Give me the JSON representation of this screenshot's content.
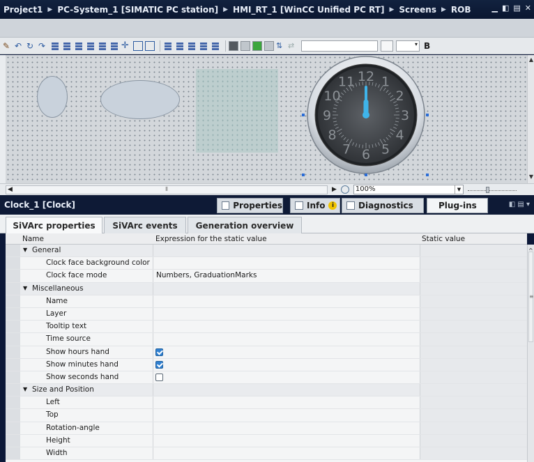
{
  "breadcrumb": [
    "Project1",
    "PC-System_1 [SIMATIC PC station]",
    "HMI_RT_1 [WinCC Unified PC RT]",
    "Screens",
    "ROB"
  ],
  "toolbar": {
    "bold_label": "B"
  },
  "canvas": {
    "clock_numbers": [
      "12",
      "1",
      "2",
      "3",
      "4",
      "5",
      "6",
      "7",
      "8",
      "9",
      "10",
      "11"
    ]
  },
  "zoom": {
    "value": "100%"
  },
  "inspector": {
    "title": "Clock_1 [Clock]",
    "tabs": [
      "Properties",
      "Info",
      "Diagnostics",
      "Plug-ins"
    ],
    "subtabs": [
      "SiVArc properties",
      "SiVArc events",
      "Generation overview"
    ]
  },
  "grid": {
    "columns": [
      "Name",
      "Expression for the static value",
      "Static value"
    ],
    "rows": [
      {
        "type": "group",
        "label": "General"
      },
      {
        "label": "Clock face background color",
        "expr": ""
      },
      {
        "label": "Clock face mode",
        "expr": "Numbers, GraduationMarks"
      },
      {
        "type": "group",
        "label": "Miscellaneous"
      },
      {
        "label": "Name",
        "expr": ""
      },
      {
        "label": "Layer",
        "expr": ""
      },
      {
        "label": "Tooltip text",
        "expr": ""
      },
      {
        "label": "Time source",
        "expr": ""
      },
      {
        "label": "Show hours hand",
        "checkbox": true
      },
      {
        "label": "Show minutes hand",
        "checkbox": true
      },
      {
        "label": "Show seconds hand",
        "checkbox": false
      },
      {
        "type": "group",
        "label": "Size and Position"
      },
      {
        "label": "Left",
        "expr": ""
      },
      {
        "label": "Top",
        "expr": ""
      },
      {
        "label": "Rotation-angle",
        "expr": ""
      },
      {
        "label": "Height",
        "expr": ""
      },
      {
        "label": "Width",
        "expr": ""
      }
    ]
  },
  "colors": {
    "accent": "#2f7fd0",
    "hand": "#3fb4ea",
    "chrome": "#0c1838"
  }
}
